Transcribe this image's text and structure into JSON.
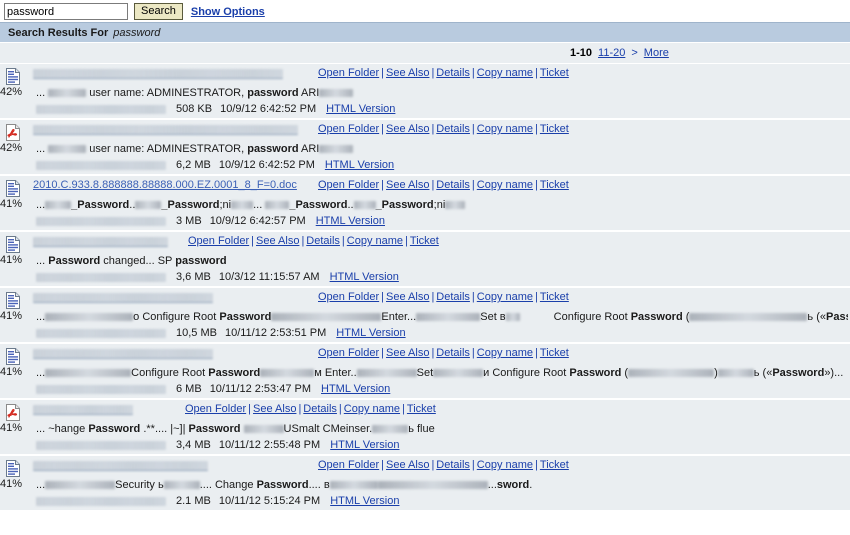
{
  "search": {
    "query_value": "password",
    "placeholder": "",
    "search_button_label": "Search",
    "show_options_label": "Show Options"
  },
  "results_header": {
    "label": "Search Results For",
    "query": "password"
  },
  "pager": {
    "current_range": "1-10",
    "next_range_label": "11-20",
    "next_arrow_label": ">",
    "more_label": "More"
  },
  "actions": {
    "open_folder": "Open Folder",
    "see_also": "See Also",
    "details": "Details",
    "copy_name": "Copy name",
    "ticket": "Ticket",
    "separator": "|"
  },
  "labels": {
    "html_version": "HTML Version"
  },
  "colors": {
    "header_blue": "#b9cbdf",
    "row_bg": "#eaeef1",
    "link_blue": "#1a3faa",
    "button_khaki": "#ece8c4",
    "title_link": "#3a5fb5"
  },
  "results": [
    {
      "icon": "doc-icon",
      "percent": "42%",
      "title_redacted": true,
      "title": "",
      "snippet_prefix": "...",
      "snippet_text": "user name: ADMINESTRATOR,",
      "snippet_bold": "password",
      "snippet_suffix": "ARI",
      "size": "508 KB",
      "date": "10/9/12 6:42:52 PM"
    },
    {
      "icon": "pdf-icon",
      "percent": "42%",
      "title_redacted": true,
      "title": "",
      "snippet_prefix": "...",
      "snippet_text": "user name: ADMINESTRATOR,",
      "snippet_bold": "password",
      "snippet_suffix": "ARI",
      "size": "6,2 MB",
      "date": "10/9/12 6:42:52 PM"
    },
    {
      "icon": "doc-icon",
      "percent": "41%",
      "title_redacted": false,
      "title": "2010.C.933.8.888888.88888.000.EZ.0001_8_F=0.doc",
      "snippet_prefix": "...",
      "snippet_text": "_Password.._Password;ni.... _Password.._Password;ni",
      "snippet_bold": "Password",
      "snippet_suffix": "",
      "size": "3 MB",
      "date": "10/9/12 6:42:57 PM"
    },
    {
      "icon": "doc-icon",
      "percent": "41%",
      "title_redacted": true,
      "title": "",
      "snippet_prefix": "...",
      "snippet_text": "changed... SP",
      "snippet_bold": "Password",
      "snippet_suffix": "password",
      "size": "3,6 MB",
      "date": "10/3/12 11:15:57 AM"
    },
    {
      "icon": "doc-icon",
      "percent": "41%",
      "title_redacted": true,
      "title": "",
      "snippet_prefix": "...",
      "snippet_text": "Configure Root",
      "snippet_bold": "Password",
      "snippet_suffix": "Enter... Set в",
      "snippet_tail_text": "Configure Root",
      "snippet_tail_bold": "Password",
      "snippet_tail_suffix": "(   ) ь («Password»)...",
      "size": "10,5 MB",
      "date": "10/11/12 2:53:51 PM"
    },
    {
      "icon": "doc-icon",
      "percent": "41%",
      "title_redacted": true,
      "title": "",
      "snippet_prefix": "...",
      "snippet_text": "Configure Root",
      "snippet_bold": "Password",
      "snippet_suffix": "м Enter.. Set в",
      "snippet_tail_text": "и Configure Root",
      "snippet_tail_bold": "Password",
      "snippet_tail_suffix": "(  ) ь («Password»)...",
      "size": "6 MB",
      "date": "10/11/12 2:53:47 PM"
    },
    {
      "icon": "pdf-icon",
      "percent": "41%",
      "title_redacted": true,
      "title": "",
      "snippet_prefix": "...",
      "snippet_text": "~hange Password .**.... |~]|",
      "snippet_bold": "Password",
      "snippet_suffix": "USmalt CMeinser.  ь flue",
      "size": "3,4 MB",
      "date": "10/11/12 2:55:48 PM"
    },
    {
      "icon": "doc-icon",
      "percent": "41%",
      "title_redacted": true,
      "title": "",
      "snippet_prefix": "...",
      "snippet_text": "Security ь  .... Change",
      "snippet_bold": "Password",
      "snippet_suffix": ".... в",
      "snippet_tail_suffix": "sword.",
      "size": "2.1 MB",
      "date": "10/11/12 5:15:24 PM"
    }
  ]
}
